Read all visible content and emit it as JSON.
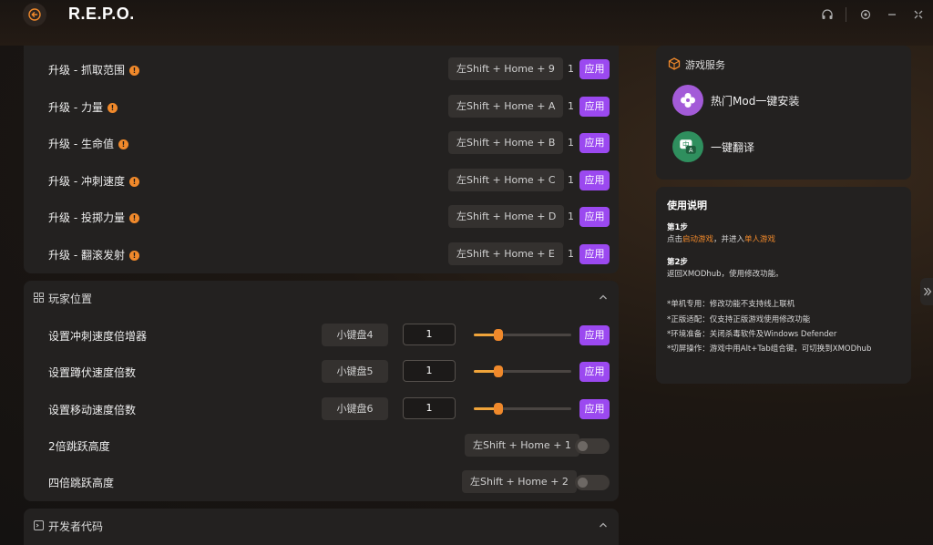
{
  "app": {
    "title": "R.E.P.O."
  },
  "upgrades": [
    {
      "label": "升级 - 抓取范围",
      "hotkey": "左Shift + Home + 9",
      "count": "1",
      "apply": "应用"
    },
    {
      "label": "升级 - 力量",
      "hotkey": "左Shift + Home + A",
      "count": "1",
      "apply": "应用"
    },
    {
      "label": "升级 - 生命值",
      "hotkey": "左Shift + Home + B",
      "count": "1",
      "apply": "应用"
    },
    {
      "label": "升级 - 冲刺速度",
      "hotkey": "左Shift + Home + C",
      "count": "1",
      "apply": "应用"
    },
    {
      "label": "升级 - 投掷力量",
      "hotkey": "左Shift + Home + D",
      "count": "1",
      "apply": "应用"
    },
    {
      "label": "升级 - 翻滚发射",
      "hotkey": "左Shift + Home + E",
      "count": "1",
      "apply": "应用"
    }
  ],
  "player_section": {
    "title": "玩家位置",
    "sliders": [
      {
        "label": "设置冲刺速度倍增器",
        "hotkey": "小键盘4",
        "value": "1",
        "slider_fraction": 0.25,
        "apply": "应用"
      },
      {
        "label": "设置蹲伏速度倍数",
        "hotkey": "小键盘5",
        "value": "1",
        "slider_fraction": 0.25,
        "apply": "应用"
      },
      {
        "label": "设置移动速度倍数",
        "hotkey": "小键盘6",
        "value": "1",
        "slider_fraction": 0.25,
        "apply": "应用"
      }
    ],
    "toggles": [
      {
        "label": "2倍跳跃高度",
        "hotkey": "左Shift + Home + 1",
        "on": false
      },
      {
        "label": "四倍跳跃高度",
        "hotkey": "左Shift + Home + 2",
        "on": false
      }
    ]
  },
  "dev_section": {
    "title": "开发者代码"
  },
  "game_services": {
    "title": "游戏服务",
    "items": [
      {
        "label": "热门Mod一键安装",
        "icon": "flower-icon",
        "color": "#a35bd8"
      },
      {
        "label": "一键翻译",
        "icon": "translate-icon",
        "color": "#2f8f5e"
      }
    ]
  },
  "instructions": {
    "title": "使用说明",
    "step1_title": "第1步",
    "step1_a": "点击",
    "step1_link1": "启动游戏",
    "step1_b": "，并进入",
    "step1_link2": "单人游戏",
    "step2_title": "第2步",
    "step2_text": "返回XMODhub，使用修改功能。",
    "notes": [
      "*单机专用：修改功能不支持线上联机",
      "*正版适配：仅支持正版游戏使用修改功能",
      "*环境准备：关闭杀毒软件及Windows Defender",
      "*切屏操作：游戏中用Alt+Tab组合键，可切换到XMODhub"
    ]
  },
  "colors": {
    "accent": "#9b49f0",
    "orange": "#f0892b"
  }
}
